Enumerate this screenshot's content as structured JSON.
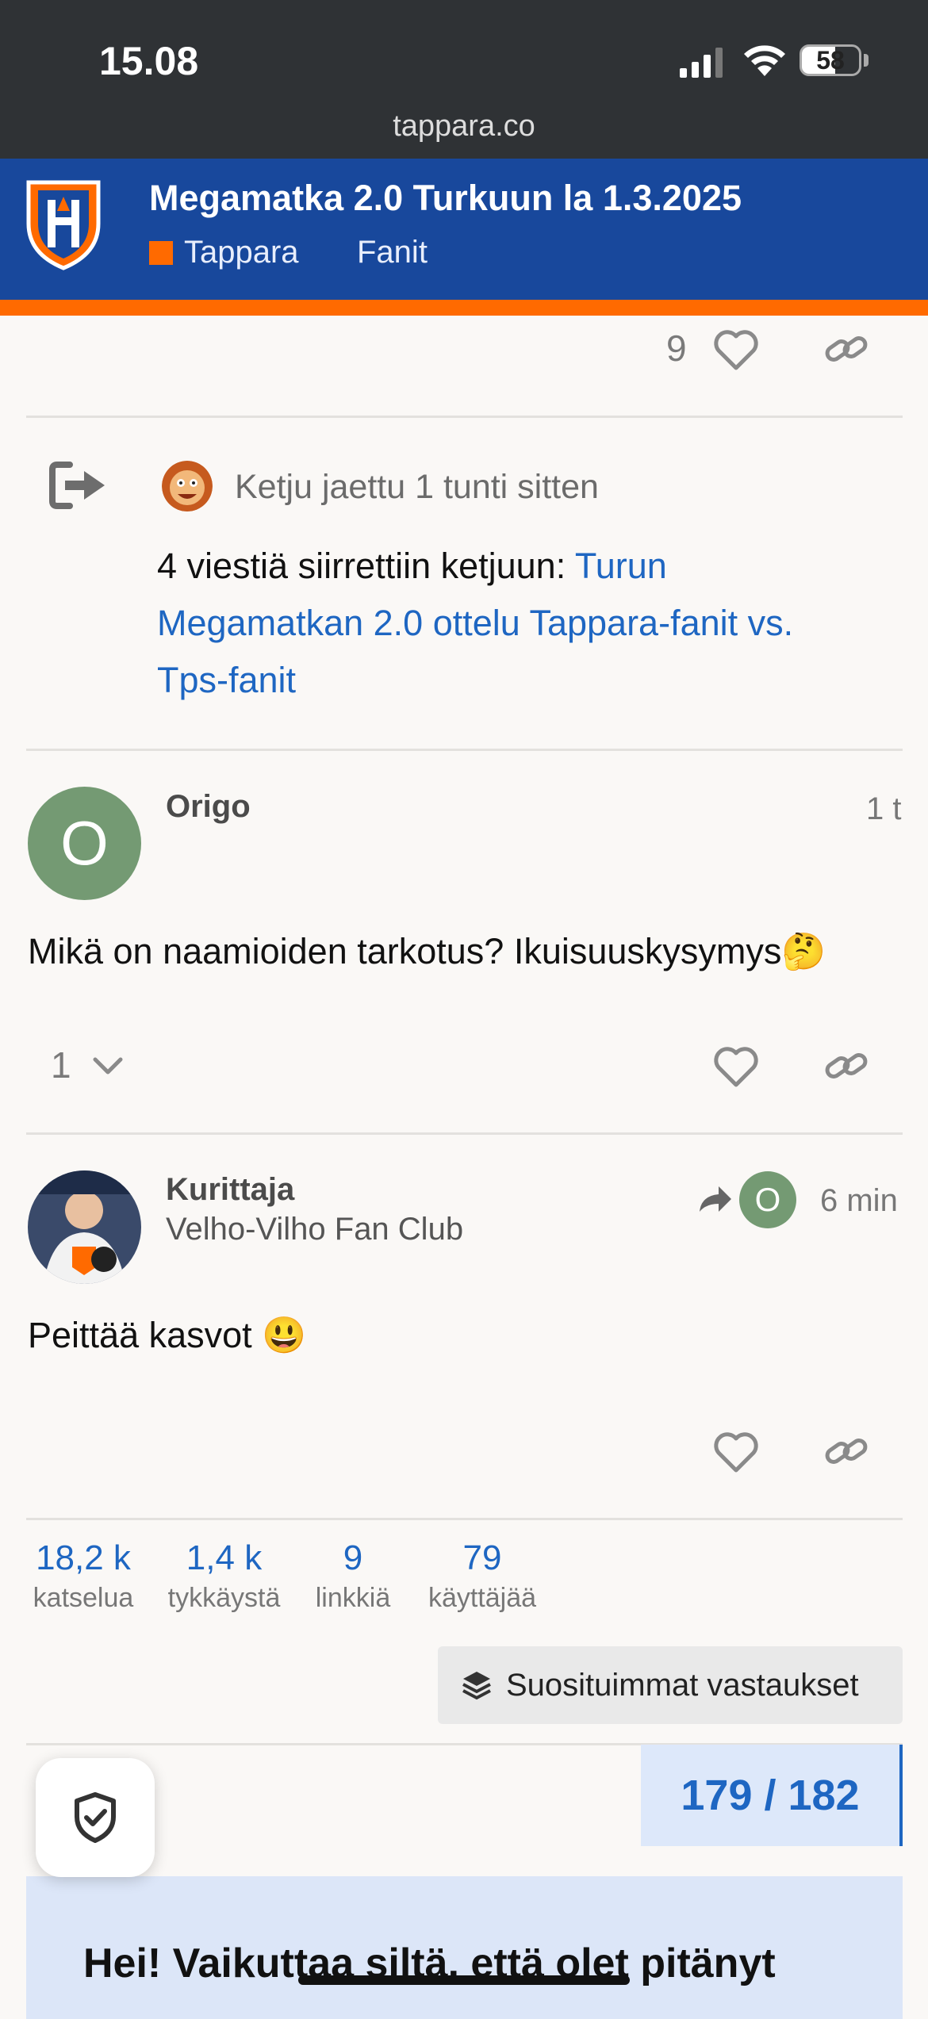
{
  "status_bar": {
    "time": "15.08",
    "battery": "58",
    "url": "tappara.co"
  },
  "header": {
    "title": "Megamatka 2.0 Turkuun la 1.3.2025",
    "category": "Tappara",
    "tag": "Fanit"
  },
  "previous_post": {
    "like_count": "9"
  },
  "split_notice": {
    "meta": "Ketju jaettu 1 tunti sitten",
    "text": "4 viestiä siirrettiin ketjuun: ",
    "link_line1": "Turun",
    "link_line2": "Megamatkan 2.0 ottelu Tappara-fanit vs.",
    "link_line3": "Tps-fanit"
  },
  "post_origo": {
    "avatar_letter": "O",
    "username": "Origo",
    "time": "1 t",
    "body": "Mikä on naamioiden tarkotus? Ikuisuuskysymys",
    "emoji": "🤔",
    "replies_count": "1"
  },
  "post_kurittaja": {
    "username": "Kurittaja",
    "group": "Velho-Vilho Fan Club",
    "reply_to_letter": "O",
    "time": "6 min",
    "body": "Peittää kasvot ",
    "emoji": "😃"
  },
  "stats": [
    {
      "value": "18,2 k",
      "label": "katselua"
    },
    {
      "value": "1,4 k",
      "label": "tykkäystä"
    },
    {
      "value": "9",
      "label": "linkkiä"
    },
    {
      "value": "79",
      "label": "käyttäjää"
    }
  ],
  "top_replies_label": "Suosituimmat vastaukset",
  "progress": "179 / 182",
  "banner_text": "Hei! Vaikuttaa siltä, että olet pitänyt",
  "colors": {
    "header_bg": "#18489c",
    "accent": "#ff6a00",
    "link": "#1e66c2",
    "avatar_green": "#749a73"
  }
}
